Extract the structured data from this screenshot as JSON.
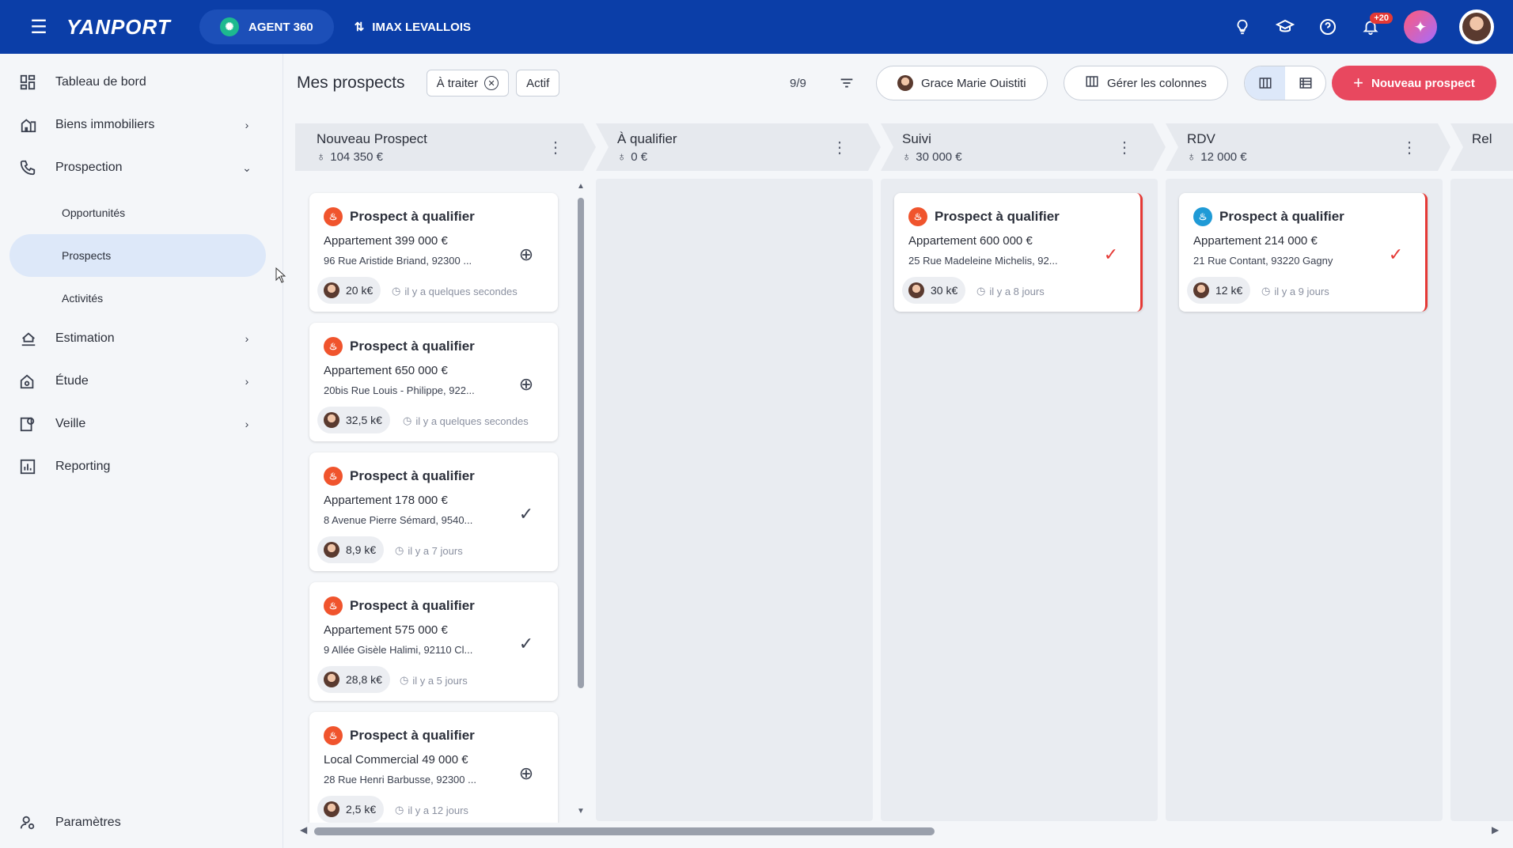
{
  "topbar": {
    "logo": "YANPORT",
    "agent_label": "AGENT 360",
    "agency_label": "IMAX LEVALLOIS",
    "notif_count": "+20",
    "icons": [
      "menu-icon",
      "bulb-icon",
      "graduation-cap-icon",
      "help-icon",
      "bell-icon",
      "sparkle-icon"
    ]
  },
  "sidebar": {
    "items": [
      {
        "label": "Tableau de bord",
        "icon": "dashboard-icon"
      },
      {
        "label": "Biens immobiliers",
        "icon": "buildings-icon"
      },
      {
        "label": "Prospection",
        "icon": "phone-icon"
      },
      {
        "label": "Estimation",
        "icon": "house-hand-icon"
      },
      {
        "label": "Étude",
        "icon": "house-search-icon"
      },
      {
        "label": "Veille",
        "icon": "watch-icon"
      },
      {
        "label": "Reporting",
        "icon": "chart-icon"
      }
    ],
    "sub_items": [
      "Opportunités",
      "Prospects",
      "Activités"
    ],
    "settings": "Paramètres"
  },
  "header": {
    "title": "Mes prospects",
    "chips": [
      "À traiter",
      "Actif"
    ],
    "count": "9/9",
    "user_filter": "Grace Marie Ouistiti",
    "columns_btn": "Gérer les colonnes",
    "new_btn": "Nouveau prospect"
  },
  "columns": [
    {
      "title": "Nouveau Prospect",
      "amount": "104 350 €"
    },
    {
      "title": "À qualifier",
      "amount": "0 €"
    },
    {
      "title": "Suivi",
      "amount": "30 000 €"
    },
    {
      "title": "RDV",
      "amount": "12 000 €"
    },
    {
      "title": "Rel"
    }
  ],
  "cards": {
    "col0": [
      {
        "title": "Prospect à qualifier",
        "price": "Appartement 399 000 €",
        "address": "96 Rue Aristide Briand, 92300 ...",
        "fee": "20 k€",
        "time": "il y a quelques secondes"
      },
      {
        "title": "Prospect à qualifier",
        "price": "Appartement 650 000 €",
        "address": "20bis Rue Louis - Philippe, 922...",
        "fee": "32,5 k€",
        "time": "il y a quelques secondes"
      },
      {
        "title": "Prospect à qualifier",
        "price": "Appartement 178 000 €",
        "address": "8 Avenue Pierre Sémard, 9540...",
        "fee": "8,9 k€",
        "time": "il y a 7 jours"
      },
      {
        "title": "Prospect à qualifier",
        "price": "Appartement 575 000 €",
        "address": "9 Allée Gisèle Halimi, 92110 Cl...",
        "fee": "28,8 k€",
        "time": "il y a 5 jours"
      },
      {
        "title": "Prospect à qualifier",
        "price": "Local Commercial 49 000 €",
        "address": "28 Rue Henri Barbusse, 92300 ...",
        "fee": "2,5 k€",
        "time": "il y a 12 jours"
      }
    ],
    "col2": [
      {
        "title": "Prospect à qualifier",
        "price": "Appartement 600 000 €",
        "address": "25 Rue Madeleine Michelis, 92...",
        "fee": "30 k€",
        "time": "il y a 8 jours"
      }
    ],
    "col3": [
      {
        "title": "Prospect à qualifier",
        "price": "Appartement 214 000 €",
        "address": "21 Rue Contant, 93220 Gagny",
        "fee": "12 k€",
        "time": "il y a 9 jours"
      }
    ]
  },
  "colors": {
    "topbar": "#0b3ea8",
    "primary": "#e8485f",
    "active_nav": "#dde8f9",
    "hot": "#e53935"
  }
}
